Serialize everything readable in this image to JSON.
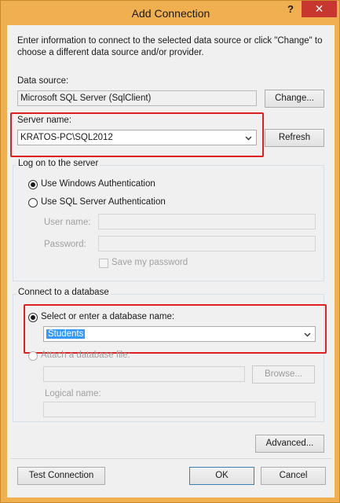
{
  "window": {
    "title": "Add Connection",
    "help_label": "?",
    "close_label": "✕"
  },
  "intro_text": "Enter information to connect to the selected data source or click \"Change\" to choose a different data source and/or provider.",
  "data_source": {
    "label": "Data source:",
    "value": "Microsoft SQL Server (SqlClient)",
    "change_label": "Change..."
  },
  "server": {
    "label": "Server name:",
    "value": "KRATOS-PC\\SQL2012",
    "refresh_label": "Refresh"
  },
  "logon": {
    "group_title": "Log on to the server",
    "windows_auth_label": "Use Windows Authentication",
    "sql_auth_label": "Use SQL Server Authentication",
    "user_name_label": "User name:",
    "password_label": "Password:",
    "save_password_label": "Save my password"
  },
  "database": {
    "group_title": "Connect to a database",
    "select_label": "Select or enter a database name:",
    "db_name_value": "Students",
    "attach_label": "Attach a database file:",
    "browse_label": "Browse...",
    "logical_name_label": "Logical name:"
  },
  "buttons": {
    "advanced": "Advanced...",
    "test": "Test Connection",
    "ok": "OK",
    "cancel": "Cancel"
  },
  "colors": {
    "title_bar": "#f0b04f",
    "close_button": "#c7372f",
    "highlight_box": "#e02020",
    "selection": "#3399ff"
  },
  "icons": {
    "dropdown": "chevron-down-icon"
  }
}
